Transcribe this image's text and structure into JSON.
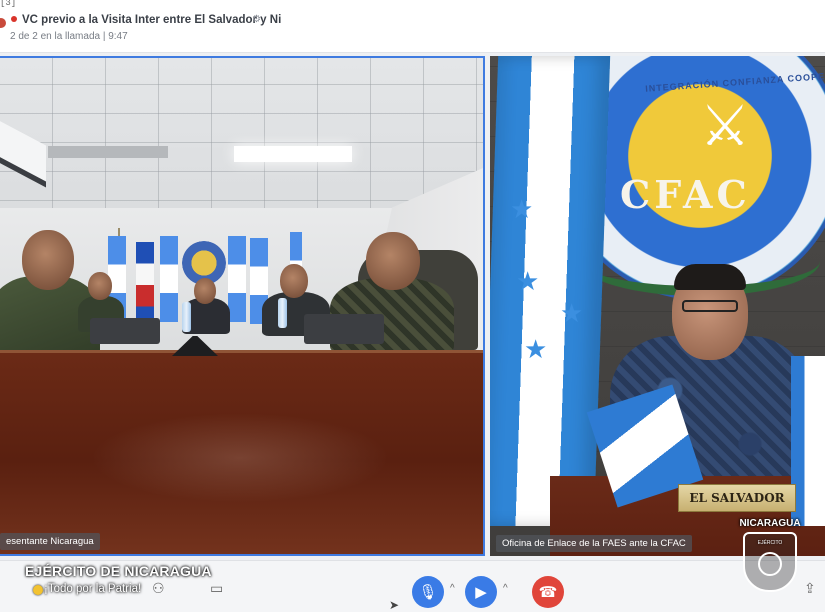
{
  "window": {
    "tab_stub": "[3]",
    "meeting_title": "VC previo a la Visita Inter entre El Salvador y Ni",
    "meeting_status": "2 de 2 en la llamada | 9:47"
  },
  "tiles": {
    "left_label": "esentante Nicaragua",
    "right_label": "Oficina de Enlace de la FAES ante la CFAC",
    "nameplate": "EL SALVADOR",
    "seal_arc": "INTEGRACIÓN CONFIANZA COOPERACIÓN",
    "seal_name": "CFAC"
  },
  "controls": {
    "mic_icon": "microphone-icon",
    "camera_icon": "camera-icon",
    "hangup_icon": "phone-hangup-icon"
  },
  "watermark": {
    "title": "EJÉRCITO DE NICARAGUA",
    "slogan": "¡Todo por la Patria!",
    "badge_title": "NICARAGUA",
    "badge_text": "EJÉRCITO"
  },
  "colors": {
    "accent": "#3a7be6",
    "hangup": "#e0453a",
    "active_border": "#3f7be0"
  }
}
